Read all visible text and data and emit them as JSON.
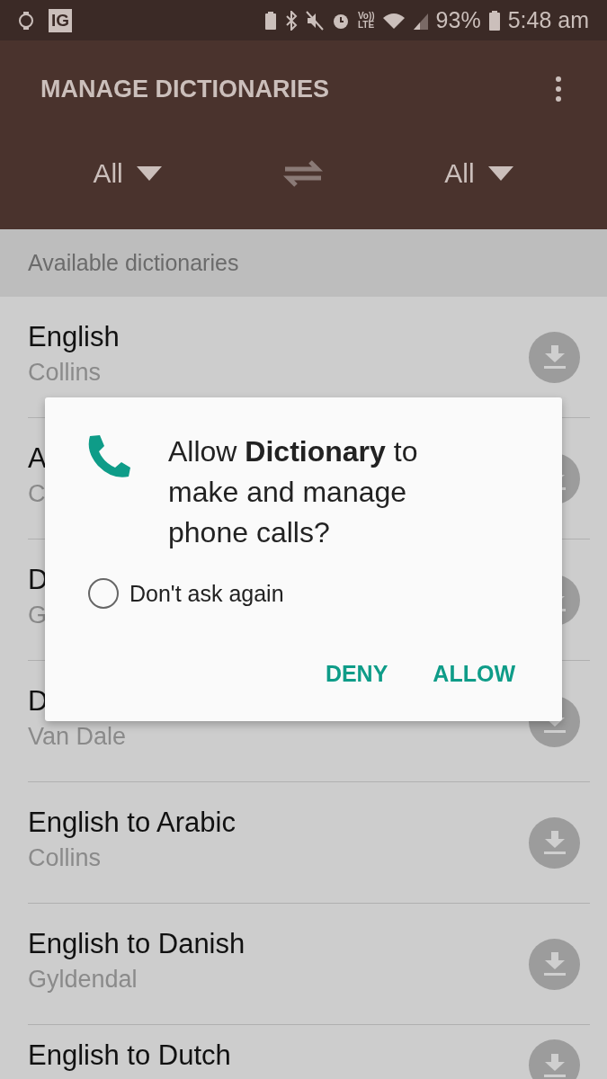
{
  "status_bar": {
    "logo": "IG",
    "volte": "Vo))",
    "lte": "LTE",
    "battery": "93%",
    "time": "5:48 am"
  },
  "app_bar": {
    "title": "MANAGE DICTIONARIES",
    "source_language": "All",
    "target_language": "All"
  },
  "section": {
    "title": "Available dictionaries"
  },
  "dictionaries": [
    {
      "name": "English",
      "publisher": "Collins"
    },
    {
      "name": "A",
      "publisher": "C"
    },
    {
      "name": "D",
      "publisher": "G"
    },
    {
      "name": "D",
      "publisher": "Van Dale"
    },
    {
      "name": "English to Arabic",
      "publisher": "Collins"
    },
    {
      "name": "English to Danish",
      "publisher": "Gyldendal"
    },
    {
      "name": "English to Dutch"
    }
  ],
  "dialog": {
    "message": "Allow **Dictionary** to make and manage phone calls?",
    "checkbox": {
      "label": "Don't ask again",
      "checked": false
    },
    "buttons": [
      "DENY",
      "ALLOW"
    ]
  }
}
